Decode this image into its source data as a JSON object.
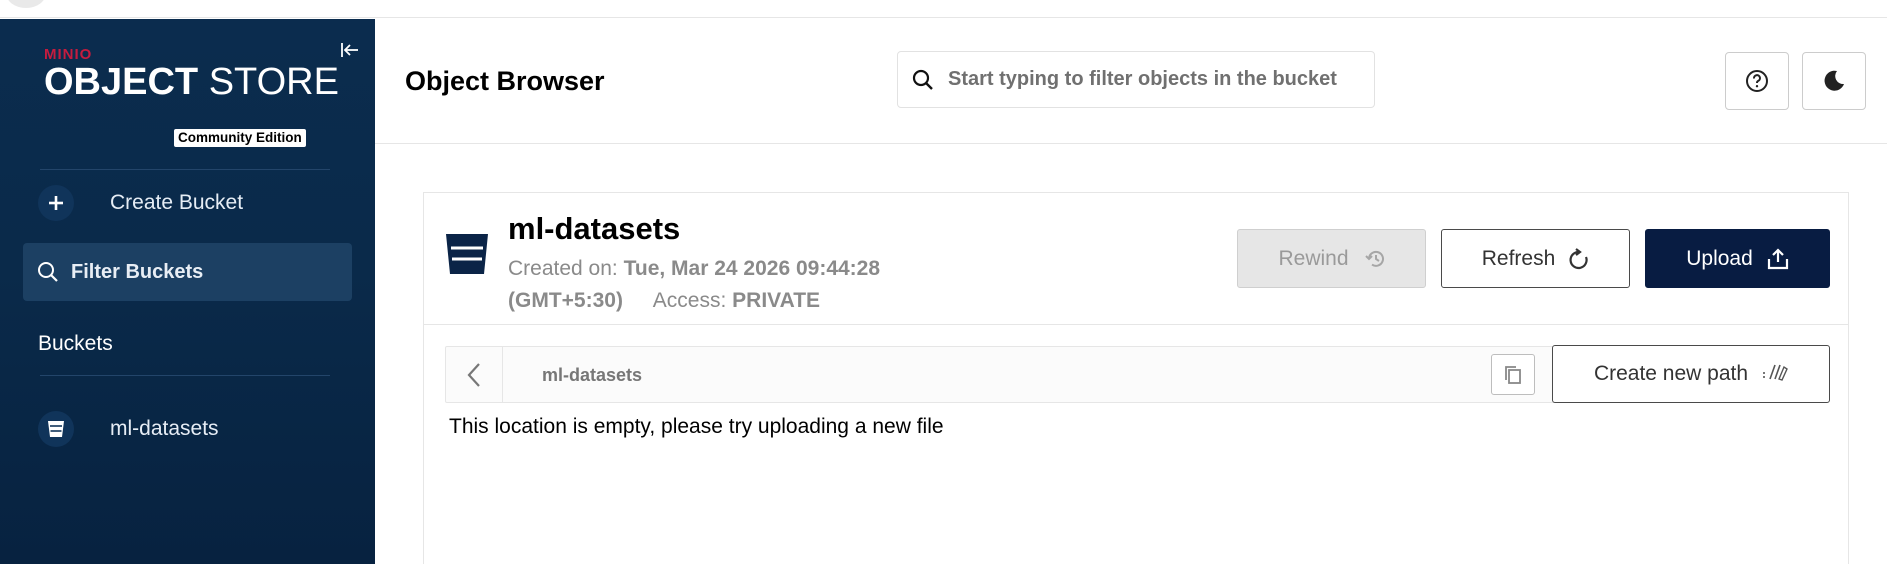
{
  "sidebar": {
    "brand": "MINIO",
    "product_bold": "OBJECT",
    "product_light": "STORE",
    "edition": "Community Edition",
    "create_bucket_label": "Create Bucket",
    "filter_placeholder": "Filter Buckets",
    "buckets_heading": "Buckets",
    "buckets": [
      {
        "label": "ml-datasets"
      }
    ]
  },
  "header": {
    "title": "Object Browser",
    "search_placeholder": "Start typing to filter objects in the bucket"
  },
  "bucket": {
    "name": "ml-datasets",
    "created_label": "Created on:",
    "created_value": "Tue, Mar 24 2026 09:44:28",
    "timezone": "(GMT+5:30)",
    "access_label": "Access:",
    "access_value": "PRIVATE"
  },
  "toolbar": {
    "rewind_label": "Rewind",
    "refresh_label": "Refresh",
    "upload_label": "Upload",
    "create_path_label": "Create new path"
  },
  "path": {
    "current": "ml-datasets"
  },
  "empty_message": "This location is empty, please try uploading a new file",
  "colors": {
    "sidebar_bg": "#0b2c4e",
    "brand_red": "#c51c3f",
    "upload_bg": "#081c42",
    "rewind_disabled": "#e6e6e6"
  }
}
